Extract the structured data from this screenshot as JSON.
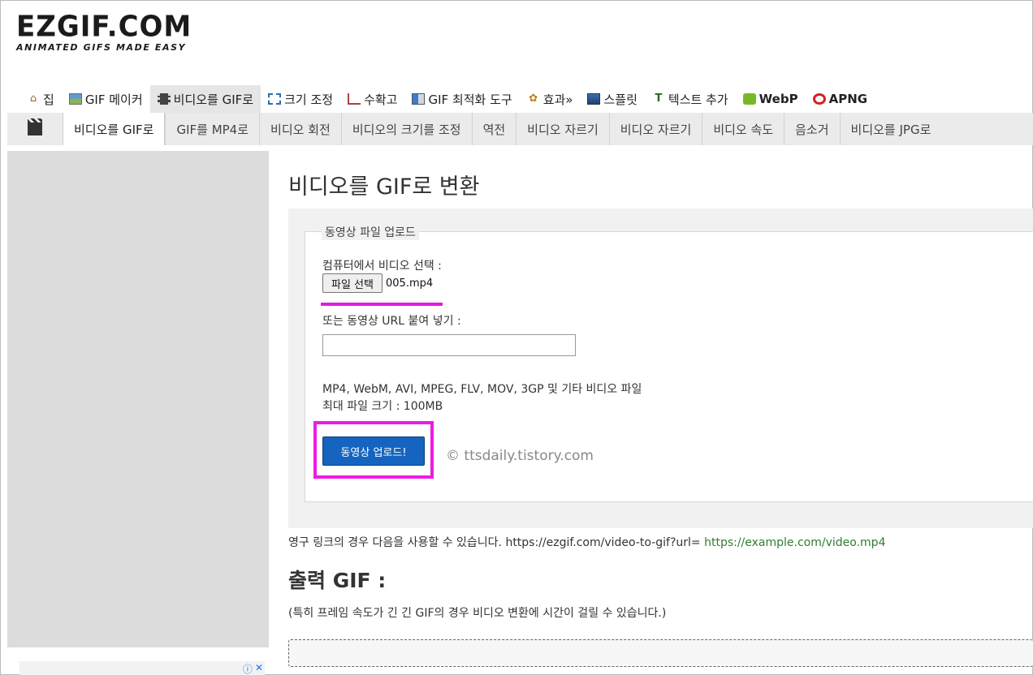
{
  "logo": {
    "main": "EZGIF.COM",
    "sub": "ANIMATED GIFS MADE EASY"
  },
  "main_nav": [
    {
      "label": "집",
      "icon": "home-icon"
    },
    {
      "label": "GIF 메이커",
      "icon": "image-icon"
    },
    {
      "label": "비디오를 GIF로",
      "icon": "film-icon",
      "active": true
    },
    {
      "label": "크기 조정",
      "icon": "resize-icon"
    },
    {
      "label": "수확고",
      "icon": "crop-icon"
    },
    {
      "label": "GIF 최적화 도구",
      "icon": "optimize-icon"
    },
    {
      "label": "효과»",
      "icon": "palette-icon"
    },
    {
      "label": "스플릿",
      "icon": "split-icon"
    },
    {
      "label": "텍스트 추가",
      "icon": "text-icon"
    },
    {
      "label": "WebP",
      "icon": "webp-icon"
    },
    {
      "label": "APNG",
      "icon": "apng-icon"
    }
  ],
  "sub_nav": [
    {
      "label": "비디오를 GIF로",
      "active": true
    },
    {
      "label": "GIF를 MP4로"
    },
    {
      "label": "비디오 회전"
    },
    {
      "label": "비디오의 크기를 조정"
    },
    {
      "label": "역전"
    },
    {
      "label": "비디오 자르기"
    },
    {
      "label": "비디오 자르기"
    },
    {
      "label": "비디오 속도"
    },
    {
      "label": "음소거"
    },
    {
      "label": "비디오를 JPG로"
    }
  ],
  "page_title": "비디오를 GIF로 변환",
  "upload": {
    "legend": "동영상 파일 업로드",
    "file_label": "컴퓨터에서 비디오 선택 :",
    "file_button": "파일 선택",
    "file_name": "005.mp4",
    "url_label": "또는 동영상 URL 붙여 넣기 :",
    "url_value": "",
    "formats": "MP4, WebM, AVI, MPEG, FLV, MOV, 3GP 및 기타 비디오 파일",
    "max_size": "최대 파일 크기 : 100MB",
    "submit": "동영상 업로드!",
    "watermark": "© ttsdaily.tistory.com"
  },
  "permalink": {
    "text": "영구 링크의 경우 다음을 사용할 수 있습니다. https://ezgif.com/video-to-gif?url= ",
    "link": "https://example.com/video.mp4"
  },
  "output": {
    "title": "출력 GIF :",
    "note": "(특히 프레임 속도가 긴 긴 GIF의 경우 비디오 변환에 시간이 걸릴 수 있습니다.)"
  },
  "ad": {
    "info_icon": "ⓘ",
    "close_icon": "✕"
  },
  "colors": {
    "accent_blue": "#1565c0",
    "highlight_magenta": "#ee1be3",
    "link_green": "#2f7d2f"
  }
}
